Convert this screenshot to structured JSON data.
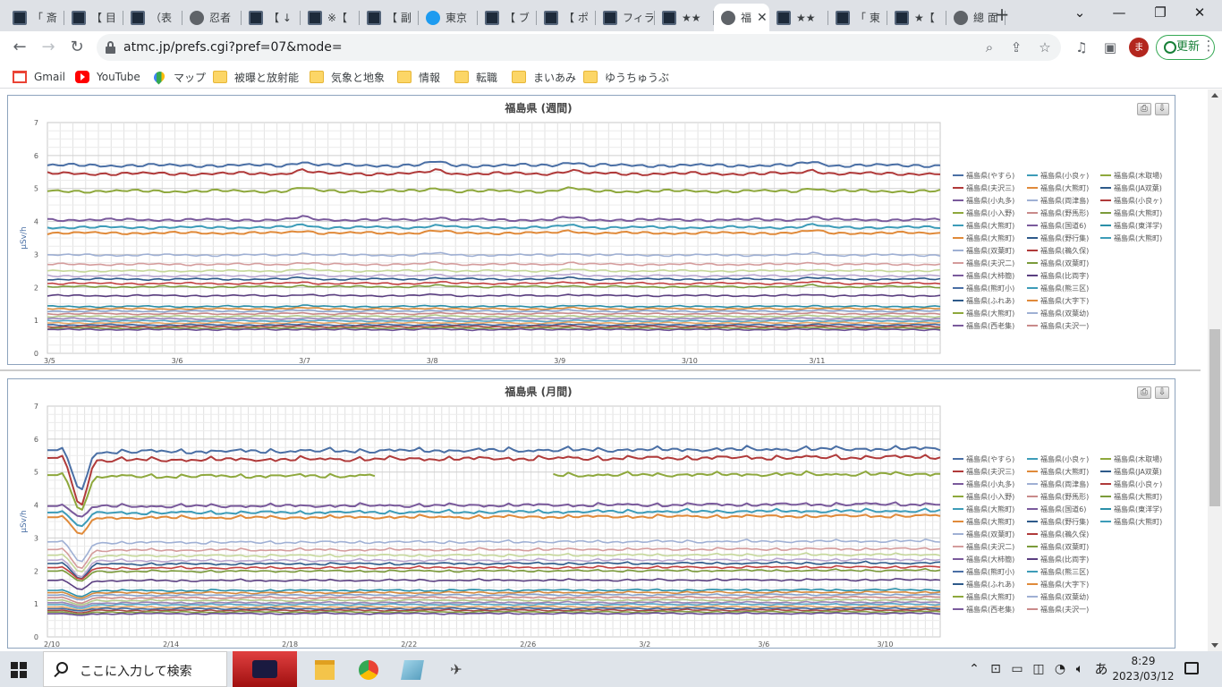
{
  "browser": {
    "tabs": [
      {
        "label": "「 斎",
        "icon": "dark-site-icon"
      },
      {
        "label": "【 目",
        "icon": "dark-site-icon"
      },
      {
        "label": "（表",
        "icon": "dark-site-icon"
      },
      {
        "label": "忍者",
        "icon": "globe-icon"
      },
      {
        "label": "【 ↓",
        "icon": "dark-site-icon"
      },
      {
        "label": "※【",
        "icon": "dark-site-icon"
      },
      {
        "label": "【 副",
        "icon": "dark-site-icon"
      },
      {
        "label": "東京",
        "icon": "twitter-icon"
      },
      {
        "label": "【 ブ",
        "icon": "dark-site-icon"
      },
      {
        "label": "【 ポ",
        "icon": "dark-site-icon"
      },
      {
        "label": "フィラ",
        "icon": "dark-site-icon"
      },
      {
        "label": "★★",
        "icon": "dark-site-icon"
      },
      {
        "label": "福",
        "icon": "globe-icon",
        "active": true
      },
      {
        "label": "★★",
        "icon": "dark-site-icon"
      },
      {
        "label": "「 東",
        "icon": "dark-site-icon"
      },
      {
        "label": "★【",
        "icon": "dark-site-icon"
      },
      {
        "label": "總 面",
        "icon": "globe-icon"
      }
    ],
    "new_tab": "+",
    "url": "atmc.jp/prefs.cgi?pref=07&mode=",
    "avatar_letter": "ま",
    "update_label": "更新",
    "bookmarks": [
      {
        "label": "Gmail",
        "icon": "gmail-icon"
      },
      {
        "label": "YouTube",
        "icon": "youtube-icon"
      },
      {
        "label": "マップ",
        "icon": "maps-icon"
      },
      {
        "label": "被曝と放射能",
        "icon": "folder-icon"
      },
      {
        "label": "気象と地象",
        "icon": "folder-icon"
      },
      {
        "label": "情報",
        "icon": "folder-icon"
      },
      {
        "label": "転職",
        "icon": "folder-icon"
      },
      {
        "label": "まいあみ",
        "icon": "folder-icon"
      },
      {
        "label": "ゆうちゅうぶ",
        "icon": "folder-icon"
      }
    ]
  },
  "legend": [
    "福島県(やすら)",
    "福島県(小良ヶ)",
    "福島県(木取場)",
    "福島県(夫沢三)",
    "福島県(大熊町)",
    "福島県(JA双葉)",
    "福島県(小丸多)",
    "福島県(両津島)",
    "福島県(小良ヶ)",
    "福島県(小入野)",
    "福島県(野馬形)",
    "福島県(大熊町)",
    "福島県(大熊町)",
    "福島県(国道6)",
    "福島県(東洋学)",
    "福島県(大熊町)",
    "福島県(野行集)",
    "福島県(大熊町)",
    "福島県(双葉町)",
    "福島県(鵜久保)",
    "福島県(夫沢二)",
    "福島県(双葉町)",
    "福島県(大柿簡)",
    "福島県(比両字)",
    "福島県(熊町小)",
    "福島県(熊三区)",
    "福島県(ふれあ)",
    "福島県(大字下)",
    "福島県(大熊町)",
    "福島県(双葉幼)",
    "福島県(西老集)",
    "福島県(夫沢一)"
  ],
  "chart_data": [
    {
      "type": "line",
      "title": "福島県 (週間)",
      "ylabel": "μSv/h",
      "ylim": [
        0,
        7
      ],
      "yticks": [
        "0",
        "1",
        "2",
        "3",
        "4",
        "5",
        "6",
        "7"
      ],
      "x_ticks": [
        "3/5",
        "3/6",
        "3/7",
        "3/8",
        "3/9",
        "3/10",
        "3/11"
      ],
      "x_ticks_days": [
        0,
        1,
        2,
        3,
        4,
        5,
        6
      ],
      "x_range_days": [
        0,
        7
      ],
      "legend_position": "right",
      "grid": true,
      "series": [
        {
          "name": "福島県(やすら)",
          "color": "#4a6fa5",
          "level": 5.7
        },
        {
          "name": "福島県(夫沢三)",
          "color": "#b03a3a",
          "level": 5.45
        },
        {
          "name": "福島県(小丸多)",
          "color": "#8ea83c",
          "level": 4.92
        },
        {
          "name": "福島県(小入野)",
          "color": "#7a5a9c",
          "level": 4.05
        },
        {
          "name": "福島県(大熊町)",
          "color": "#3d9cb8",
          "level": 3.82
        },
        {
          "name": "福島県(大熊町)",
          "color": "#e08a3a",
          "level": 3.65
        },
        {
          "name": "福島県(双葉町)",
          "color": "#9fb0d4",
          "level": 2.98
        },
        {
          "name": "福島県(夫沢二)",
          "color": "#d49c9c",
          "level": 2.7
        },
        {
          "name": "福島県(大柿簡)",
          "color": "#c5d79a",
          "level": 2.5
        },
        {
          "name": "福島県(熊町小)",
          "color": "#b9a6d0",
          "level": 2.35
        },
        {
          "name": "福島県(ふれあ)",
          "color": "#2e5a8a",
          "level": 2.25
        },
        {
          "name": "福島県(大熊町)",
          "color": "#c24040",
          "level": 2.12
        },
        {
          "name": "福島県(西老集)",
          "color": "#7b9b3a",
          "level": 2.02
        },
        {
          "name": "福島県(小良ヶ)",
          "color": "#5a3e80",
          "level": 1.75
        },
        {
          "name": "福島県(大熊町)",
          "color": "#2a8fa8",
          "level": 1.42
        },
        {
          "name": "福島県(両津島)",
          "color": "#d68a3c",
          "level": 1.35
        },
        {
          "name": "福島県(野馬形)",
          "color": "#8aa4cc",
          "level": 1.28
        },
        {
          "name": "福島県(国道6)",
          "color": "#c98a8a",
          "level": 1.2
        },
        {
          "name": "福島県(野行集)",
          "color": "#b1c98a",
          "level": 1.12
        },
        {
          "name": "福島県(鵜久保)",
          "color": "#9a86b8",
          "level": 1.05
        },
        {
          "name": "福島県(双葉町)",
          "color": "#5aa8c8",
          "level": 0.98
        },
        {
          "name": "福島県(比両字)",
          "color": "#e8a868",
          "level": 0.92
        },
        {
          "name": "福島県(熊三区)",
          "color": "#3f6aa0",
          "level": 0.86
        },
        {
          "name": "福島県(大字下)",
          "color": "#a84848",
          "level": 0.81
        },
        {
          "name": "福島県(双葉幼)",
          "color": "#86a048",
          "level": 0.76
        },
        {
          "name": "福島県(夫沢一)",
          "color": "#6a4e94",
          "level": 0.72
        }
      ]
    },
    {
      "type": "line",
      "title": "福島県 (月間)",
      "ylabel": "μSv/h",
      "ylim": [
        0,
        7
      ],
      "yticks": [
        "0",
        "1",
        "2",
        "3",
        "4",
        "5",
        "6",
        "7"
      ],
      "x_ticks": [
        "2/10",
        "2/14",
        "2/18",
        "2/22",
        "2/26",
        "3/2",
        "3/6",
        "3/10"
      ],
      "x_ticks_days": [
        0,
        4,
        8,
        12,
        16,
        20,
        24,
        28
      ],
      "x_range_days": [
        0,
        30
      ],
      "legend_position": "right",
      "grid": true,
      "series": [
        {
          "name": "福島県(やすら)",
          "color": "#4a6fa5",
          "level": 5.6,
          "dip": 4.3
        },
        {
          "name": "福島県(夫沢三)",
          "color": "#b03a3a",
          "level": 5.35,
          "dip": 3.8
        },
        {
          "name": "福島県(小丸多)",
          "color": "#8ea83c",
          "level": 4.85,
          "dip": 3.7,
          "gap": [
            11,
            17
          ]
        },
        {
          "name": "福島県(小入野)",
          "color": "#7a5a9c",
          "level": 3.95,
          "dip": 3.6
        },
        {
          "name": "福島県(大熊町)",
          "color": "#3d9cb8",
          "level": 3.75,
          "dip": 3.3
        },
        {
          "name": "福島県(大熊町)",
          "color": "#e08a3a",
          "level": 3.6,
          "dip": 3.05
        },
        {
          "name": "福島県(双葉町)",
          "color": "#9fb0d4",
          "level": 2.85,
          "dip": 2.2
        },
        {
          "name": "福島県(夫沢二)",
          "color": "#d49c9c",
          "level": 2.62,
          "dip": 2.0
        },
        {
          "name": "福島県(大柿簡)",
          "color": "#c5d79a",
          "level": 2.45,
          "dip": 1.9
        },
        {
          "name": "福島県(熊町小)",
          "color": "#b9a6d0",
          "level": 2.3,
          "dip": 1.75
        },
        {
          "name": "福島県(ふれあ)",
          "color": "#2e5a8a",
          "level": 2.2,
          "dip": 1.7
        },
        {
          "name": "福島県(大熊町)",
          "color": "#c24040",
          "level": 2.08,
          "dip": 1.7
        },
        {
          "name": "福島県(西老集)",
          "color": "#7b9b3a",
          "level": 1.98,
          "dip": 1.65
        },
        {
          "name": "福島県(小良ヶ)",
          "color": "#5a3e80",
          "level": 1.7,
          "dip": 1.4
        },
        {
          "name": "福島県(大熊町)",
          "color": "#2a8fa8",
          "level": 1.4,
          "dip": 1.2
        },
        {
          "name": "福島県(両津島)",
          "color": "#d68a3c",
          "level": 1.33,
          "dip": 1.15
        },
        {
          "name": "福島県(野馬形)",
          "color": "#8aa4cc",
          "level": 1.26,
          "dip": 1.1
        },
        {
          "name": "福島県(国道6)",
          "color": "#c98a8a",
          "level": 1.18,
          "dip": 1.0
        },
        {
          "name": "福島県(野行集)",
          "color": "#b1c98a",
          "level": 1.1,
          "dip": 0.95
        },
        {
          "name": "福島県(鵜久保)",
          "color": "#9a86b8",
          "level": 1.03,
          "dip": 0.9
        },
        {
          "name": "福島県(双葉町)",
          "color": "#5aa8c8",
          "level": 0.97,
          "dip": 0.85
        },
        {
          "name": "福島県(比両字)",
          "color": "#e8a868",
          "level": 0.9,
          "dip": 0.8
        },
        {
          "name": "福島県(熊三区)",
          "color": "#3f6aa0",
          "level": 0.85,
          "dip": 0.78
        },
        {
          "name": "福島県(大字下)",
          "color": "#a84848",
          "level": 0.8,
          "dip": 0.72
        },
        {
          "name": "福島県(双葉幼)",
          "color": "#86a048",
          "level": 0.75,
          "dip": 0.68
        },
        {
          "name": "福島県(夫沢一)",
          "color": "#6a4e94",
          "level": 0.7,
          "dip": 0.65
        }
      ]
    }
  ],
  "legend_colors": [
    "#4a6fa5",
    "#3d9cb8",
    "#8ea83c",
    "#b03a3a",
    "#e08a3a",
    "#2e5a8a",
    "#7a5a9c",
    "#9fb0d4",
    "#b03a3a",
    "#8ea83c",
    "#c98a8a",
    "#7b9b3a",
    "#3d9cb8",
    "#7a5a9c",
    "#2a8fa8",
    "#e08a3a",
    "#2e5a8a",
    "#3d9cb8",
    "#9fb0d4",
    "#b03a3a",
    "#d49c9c",
    "#7b9b3a",
    "#7a5a9c",
    "#5a3e80",
    "#4a6fa5",
    "#3d9cb8",
    "#2e5a8a",
    "#e08a3a",
    "#8ea83c",
    "#9fb0d4",
    "#7a5a9c",
    "#c98a8a"
  ],
  "taskbar": {
    "search_placeholder": "ここに入力して検索",
    "time": "8:29",
    "date": "2023/03/12",
    "ime": "あ"
  }
}
